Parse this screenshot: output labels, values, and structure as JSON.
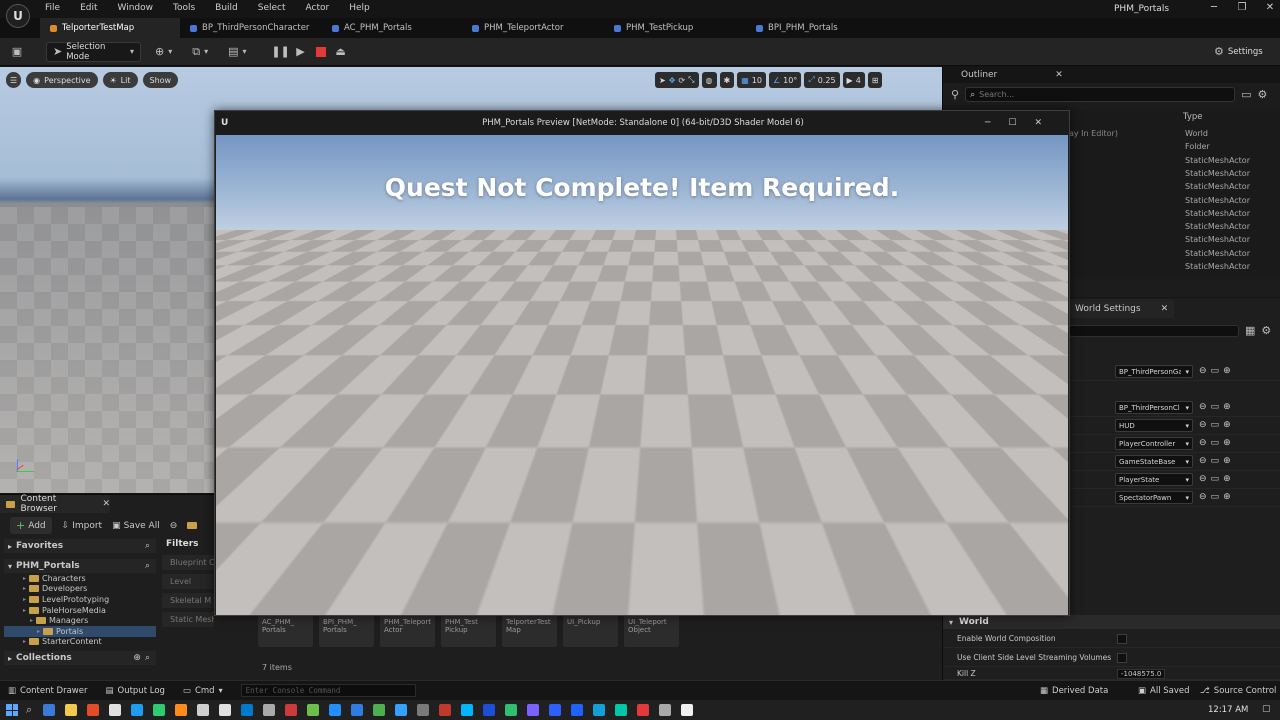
{
  "menubar": {
    "items": [
      "File",
      "Edit",
      "Window",
      "Tools",
      "Build",
      "Select",
      "Actor",
      "Help"
    ],
    "project_title": "PHM_Portals"
  },
  "tabs": [
    {
      "label": "TelporterTestMap",
      "color": "#e08a2c",
      "active": true
    },
    {
      "label": "BP_ThirdPersonCharacter",
      "color": "#4a78d6",
      "active": false
    },
    {
      "label": "AC_PHM_Portals",
      "color": "#4a78d6",
      "active": false
    },
    {
      "label": "PHM_TeleportActor",
      "color": "#4a78d6",
      "active": false
    },
    {
      "label": "PHM_TestPickup",
      "color": "#4a78d6",
      "active": false
    },
    {
      "label": "BPI_PHM_Portals",
      "color": "#4a78d6",
      "active": false
    }
  ],
  "toolbar": {
    "selection_mode": "Selection Mode",
    "settings": "Settings"
  },
  "viewport": {
    "perspective": "Perspective",
    "lit": "Lit",
    "show": "Show",
    "grid_snap": "10",
    "rotation_snap": "10°",
    "scale_snap": "0.25",
    "camera_speed": "4"
  },
  "preview": {
    "title": "PHM_Portals Preview [NetMode: Standalone 0]  (64-bit/D3D Shader Model 6)",
    "message": "Quest Not Complete! Item Required."
  },
  "outliner": {
    "title": "Outliner",
    "search_placeholder": "Search...",
    "type_header": "Type",
    "partial_label": "ay In Editor)",
    "types": [
      "World",
      "Folder",
      "StaticMeshActor",
      "StaticMeshActor",
      "StaticMeshActor",
      "StaticMeshActor",
      "StaticMeshActor",
      "StaticMeshActor",
      "StaticMeshActor",
      "StaticMeshActor",
      "StaticMeshActor"
    ]
  },
  "details": {
    "tab_label": "World Settings",
    "game_mode_combos": [
      "BP_ThirdPersonGa",
      "BP_ThirdPersonCl",
      "HUD",
      "PlayerController",
      "GameStateBase",
      "PlayerState",
      "SpectatorPawn"
    ],
    "world_section": "World",
    "enable_world_composition": "Enable World Composition",
    "client_side_streaming": "Use Client Side Level Streaming Volumes",
    "kill_z_label": "Kill Z",
    "kill_z_value": "-1048575.0"
  },
  "content_browser": {
    "title": "Content Browser",
    "add": "Add",
    "import": "Import",
    "save_all": "Save All",
    "favorites": "Favorites",
    "root": "PHM_Portals",
    "tree": [
      {
        "label": "Characters",
        "depth": 1
      },
      {
        "label": "Developers",
        "depth": 1
      },
      {
        "label": "LevelPrototyping",
        "depth": 1
      },
      {
        "label": "PaleHorseMedia",
        "depth": 1
      },
      {
        "label": "Managers",
        "depth": 2
      },
      {
        "label": "Portals",
        "depth": 3
      },
      {
        "label": "StarterContent",
        "depth": 1
      }
    ],
    "collections": "Collections",
    "filters_title": "Filters",
    "filters": [
      "Blueprint C",
      "Level",
      "Skeletal M",
      "Static Mesh"
    ],
    "assets": [
      "AC_PHM_ Portals",
      "BPI_PHM_ Portals",
      "PHM_Teleport Actor",
      "PHM_Test Pickup",
      "TelporterTest Map",
      "UI_Pickup",
      "UI_Teleport Object"
    ],
    "item_count": "7 items"
  },
  "statusbar": {
    "content_drawer": "Content Drawer",
    "output_log": "Output Log",
    "cmd": "Cmd",
    "console_placeholder": "Enter Console Command",
    "derived_data": "Derived Data",
    "all_saved": "All Saved",
    "source_control": "Source Control"
  },
  "taskbar": {
    "time": "12:17 AM"
  }
}
